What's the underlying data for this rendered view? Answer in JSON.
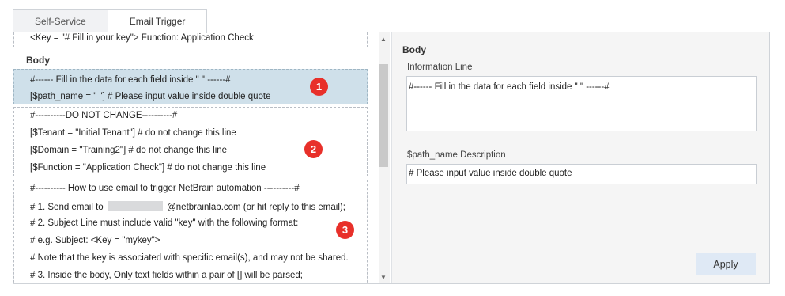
{
  "tabs": [
    {
      "label": "Self-Service"
    },
    {
      "label": "Email Trigger"
    }
  ],
  "left": {
    "key_line": "<Key = \"# Fill in your key\"> Function: Application Check",
    "body_label": "Body",
    "section1": {
      "lines": [
        "#------ Fill in the data for each field inside \" \" ------#",
        "[$path_name = \" \"] # Please input value inside double quote"
      ],
      "badge": "1"
    },
    "section2": {
      "lines": [
        "#----------DO NOT CHANGE----------#",
        "[$Tenant = \"Initial Tenant\"] # do not change this line",
        "[$Domain = \"Training2\"] # do not change this line",
        "[$Function = \"Application Check\"] # do not change this line"
      ],
      "badge": "2"
    },
    "section3": {
      "line0": "#---------- How to use email to trigger NetBrain automation ----------#",
      "line1_prefix": "# 1. Send email to",
      "line1_suffix": "@netbrainlab.com (or hit reply to this email);",
      "line2": "# 2. Subject Line must include valid \"key\" with the following format:",
      "line3": "# e.g. Subject: <Key = \"mykey\">",
      "line4": "# Note that the key is associated with specific email(s), and may not be shared.",
      "line5": "# 3. Inside the body, Only text fields within a pair of [] will be parsed;",
      "badge": "3"
    }
  },
  "right": {
    "title": "Body",
    "info_label": "Information Line",
    "info_value": "#------ Fill in the data for each field inside \" \" ------#",
    "path_label": "$path_name Description",
    "path_value": "# Please input value inside double quote",
    "apply_label": "Apply"
  },
  "colors": {
    "selected_section": "#cfe0ea",
    "badge": "#e8302a",
    "apply_button": "#dfe9f5"
  }
}
